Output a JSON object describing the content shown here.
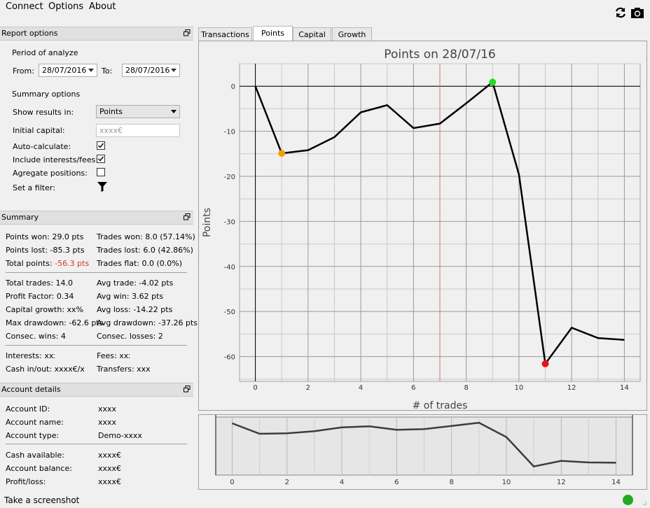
{
  "menu": [
    "Connect",
    "Options",
    "About"
  ],
  "toolbar": {
    "refresh_icon": "refresh-icon",
    "camera_icon": "camera-icon"
  },
  "report_options": {
    "title": "Report options",
    "period_label": "Period of analyze",
    "from_label": "From:",
    "from_value": "28/07/2016",
    "to_label": "To:",
    "to_value": "28/07/2016",
    "summary_label": "Summary options",
    "show_results_label": "Show results in:",
    "show_results_value": "Points",
    "initial_capital_label": "Initial capital:",
    "initial_capital_placeholder": "xxxx€",
    "auto_calc_label": "Auto-calculate:",
    "auto_calc_checked": true,
    "include_label": "Include interests/fees:",
    "include_checked": true,
    "aggregate_label": "Agregate positions:",
    "aggregate_checked": false,
    "filter_label": "Set a filter:"
  },
  "summary": {
    "title": "Summary",
    "points_won": "Points won: 29.0 pts",
    "points_lost": "Points lost: -85.3 pts",
    "total_points_label": "Total points: ",
    "total_points_value": "-56.3 pts",
    "trades_won": "Trades won: 8.0 (57.14%)",
    "trades_lost": "Trades lost: 6.0 (42.86%)",
    "trades_flat": "Trades flat: 0.0 (0.0%)",
    "total_trades": "Total trades: 14.0",
    "profit_factor": "Profit Factor: 0.34",
    "capital_growth": "Capital growth: xx%",
    "max_drawdown": "Max drawdown: -62.6 pts",
    "consec_wins": "Consec. wins: 4",
    "avg_trade": "Avg trade: -4.02 pts",
    "avg_win": "Avg win: 3.62 pts",
    "avg_loss": "Avg loss: -14.22 pts",
    "avg_drawdown": "Avg drawdown: -37.26 pts",
    "consec_losses": "Consec. losses: 2",
    "interests": "Interests: xxx",
    "cash_inout": "Cash in/out: xxxx€/xxx",
    "fees": "Fees: xxx",
    "transfers": "Transfers: xxxx",
    "negative_color": "#e03030"
  },
  "account": {
    "title": "Account details",
    "id_label": "Account ID:",
    "id_value": "xxxx",
    "name_label": "Account name:",
    "name_value": "xxxx",
    "type_label": "Account type:",
    "type_value": "Demo-xxxx",
    "cash_label": "Cash available:",
    "cash_value": "xxxx€",
    "balance_label": "Account balance:",
    "balance_value": "xxxx€",
    "pl_label": "Profit/loss:",
    "pl_value": "xxxx€"
  },
  "tabs": [
    "Transactions",
    "Points",
    "Capital",
    "Growth"
  ],
  "active_tab": 1,
  "status": {
    "text": "Take a screenshot",
    "indicator_color": "#22aa22"
  },
  "chart_data": {
    "type": "line",
    "title": "Points on 28/07/16",
    "xlabel": "# of trades",
    "ylabel": "Points",
    "x": [
      0,
      1,
      2,
      3,
      4,
      5,
      6,
      7,
      8,
      9,
      10,
      11,
      12,
      13,
      14
    ],
    "y": [
      0,
      -14.9,
      -14.2,
      -11.3,
      -5.8,
      -4.2,
      -9.3,
      -8.3,
      -3.8,
      0.9,
      -19.6,
      -61.6,
      -53.6,
      -55.9,
      -56.3
    ],
    "xlim": [
      -0.6,
      14.6
    ],
    "ylim": [
      -65.5,
      5
    ],
    "xticks": [
      0,
      2,
      4,
      6,
      8,
      10,
      12,
      14
    ],
    "yticks": [
      0,
      -10,
      -20,
      -30,
      -40,
      -50,
      -60
    ],
    "highlight_x": 7,
    "highlight_color": "#e07070",
    "markers": [
      {
        "x": 1,
        "y": -14.9,
        "color": "#f0a000"
      },
      {
        "x": 9,
        "y": 0.9,
        "color": "#22dd22"
      },
      {
        "x": 11,
        "y": -61.6,
        "color": "#ee1111"
      }
    ],
    "overview": {
      "xticks": [
        0,
        2,
        4,
        6,
        8,
        10,
        12,
        14
      ],
      "y": [
        0,
        -14.9,
        -14.2,
        -11.3,
        -5.8,
        -4.2,
        -9.3,
        -8.3,
        -3.8,
        0.9,
        -19.6,
        -61.6,
        -53.6,
        -55.9,
        -56.3
      ]
    }
  }
}
